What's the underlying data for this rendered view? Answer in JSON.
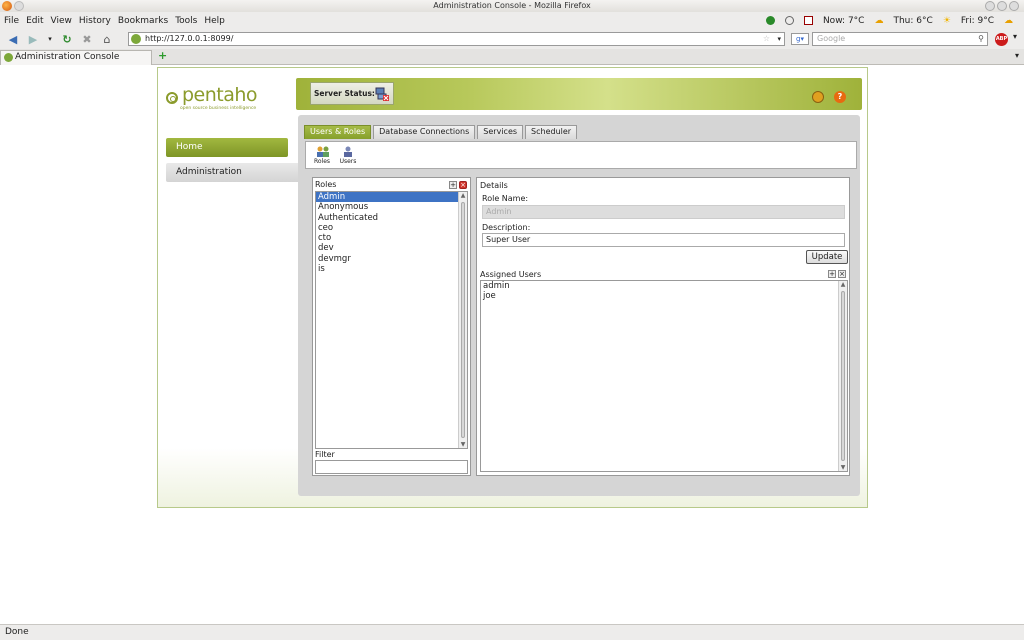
{
  "browser": {
    "window_title": "Administration Console - Mozilla Firefox",
    "menu": [
      "File",
      "Edit",
      "View",
      "History",
      "Bookmarks",
      "Tools",
      "Help"
    ],
    "weather": {
      "now": "Now: 7°C",
      "thu": "Thu: 6°C",
      "fri": "Fri: 9°C"
    },
    "url": "http://127.0.0.1:8099/",
    "search_placeholder": "Google",
    "tab_title": "Administration Console",
    "status": "Done"
  },
  "app": {
    "logo_text": "pentaho",
    "logo_tagline": "open source business intelligence",
    "nav": {
      "home": "Home",
      "administration": "Administration"
    },
    "server_status_label": "Server Status:",
    "tabs": [
      "Users & Roles",
      "Database Connections",
      "Services",
      "Scheduler"
    ],
    "subtabs": {
      "roles": "Roles",
      "users": "Users"
    },
    "roles": {
      "title": "Roles",
      "items": [
        "Admin",
        "Anonymous",
        "Authenticated",
        "ceo",
        "cto",
        "dev",
        "devmgr",
        "is"
      ],
      "selected": "Admin",
      "filter_label": "Filter"
    },
    "details": {
      "title": "Details",
      "role_name_label": "Role Name:",
      "role_name_value": "Admin",
      "description_label": "Description:",
      "description_value": "Super User",
      "update_button": "Update",
      "assigned_users_label": "Assigned Users",
      "assigned_users": [
        "admin",
        "joe"
      ]
    }
  },
  "colors": {
    "accent_green": "#8b9b2c",
    "selection_blue": "#3e73c4"
  }
}
